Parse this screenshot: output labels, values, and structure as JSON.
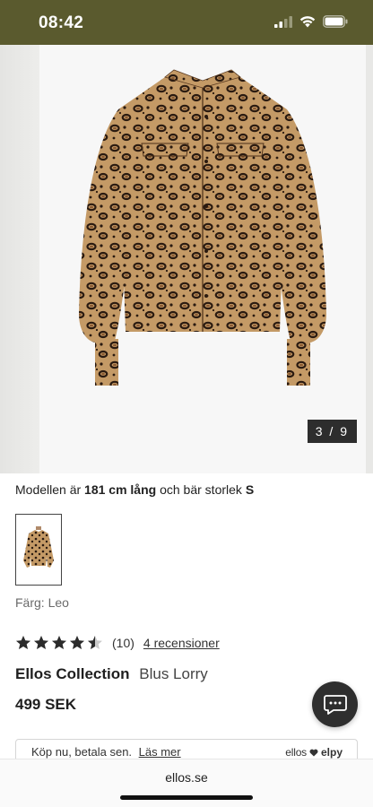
{
  "status_bar": {
    "time": "08:42",
    "icons": [
      "cellular-signal-icon",
      "wifi-icon",
      "battery-icon"
    ]
  },
  "gallery": {
    "current": "3",
    "separator": "/",
    "total": "9"
  },
  "model_info": {
    "prefix": "Modellen är",
    "height": "181 cm lång",
    "middle": "och bär storlek",
    "size": "S"
  },
  "color": {
    "label": "Färg: Leo"
  },
  "rating": {
    "value": 4.5,
    "max": 5,
    "count": "(10)",
    "reviews_link": "4 recensioner"
  },
  "product": {
    "brand": "Ellos Collection",
    "name": "Blus Lorry",
    "price": "499 SEK"
  },
  "klarna": {
    "text": "Köp nu, betala sen.",
    "link": "Läs mer",
    "logo_left": "ellos",
    "logo_right": "elpy"
  },
  "browser": {
    "url": "ellos.se"
  },
  "colors": {
    "status_bar": "#5a5a2e",
    "dark": "#2e2e2e"
  }
}
